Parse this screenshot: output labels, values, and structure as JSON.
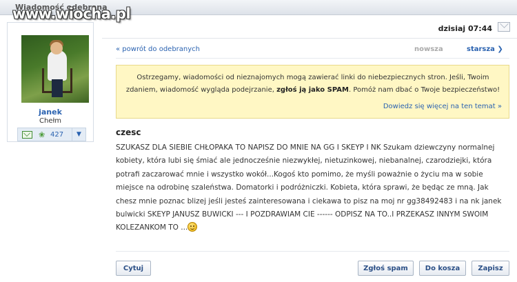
{
  "header": {
    "title": "Wiadomość odebrana",
    "watermark": "www.wiocha.pl"
  },
  "sender": {
    "username": "janek",
    "city": "Chełm",
    "friends_count": "427"
  },
  "message_meta": {
    "date": "dzisiaj 07:44"
  },
  "navigation": {
    "back_label": "« powrót do odebranych",
    "newer_label": "nowsza",
    "older_label": "starsza ❯"
  },
  "warning": {
    "text_before": "Ostrzegamy, wiadomości od nieznajomych mogą zawierać linki do niebezpiecznych stron. Jeśli, Twoim zdaniem, wiadomość wygląda podejrzanie, ",
    "text_bold": "zgłoś ją jako SPAM",
    "text_after": ". Pomóż nam dbać o Twoje bezpieczeństwo!",
    "more_link": "Dowiedz się więcej na ten temat »"
  },
  "message": {
    "subject": "czesc",
    "body": "  SZUKASZ DLA SIEBIE CHŁOPAKA TO NAPISZ DO MNIE NA GG I SKEYP I NK Szukam dziewczyny normalnej kobiety, która lubi się śmiać ale jednocześnie niezwykłej, nietuzinkowej, niebanalnej, czarodziejki, która potrafi zaczarować mnie i wszystko wokół...Kogoś kto pomimo, że myśli poważnie o życiu ma w sobie miejsce na odrobinę szaleństwa. Domatorki i podróżniczki. Kobieta, która sprawi, że będąc ze mną. Jak chesz mnie poznac blizej jeśli jesteś zainteresowana i ciekawa to pisz na moj nr gg38492483 i na nk janek bulwicki SKEYP JANUSZ BUWICKI --- I POZDRAWIAM CIE ------ ODPISZ NA TO..I PRZEKASZ INNYM SWOIM KOLEZANKOM  TO ..."
  },
  "actions": {
    "reply": "Cytuj",
    "spam": "Zgłoś spam",
    "trash": "Do kosza",
    "save": "Zapisz"
  },
  "icons": {
    "envelope": "envelope-icon",
    "mail": "mail-icon",
    "friends": "friends-icon",
    "smiley": "smiley-icon"
  }
}
